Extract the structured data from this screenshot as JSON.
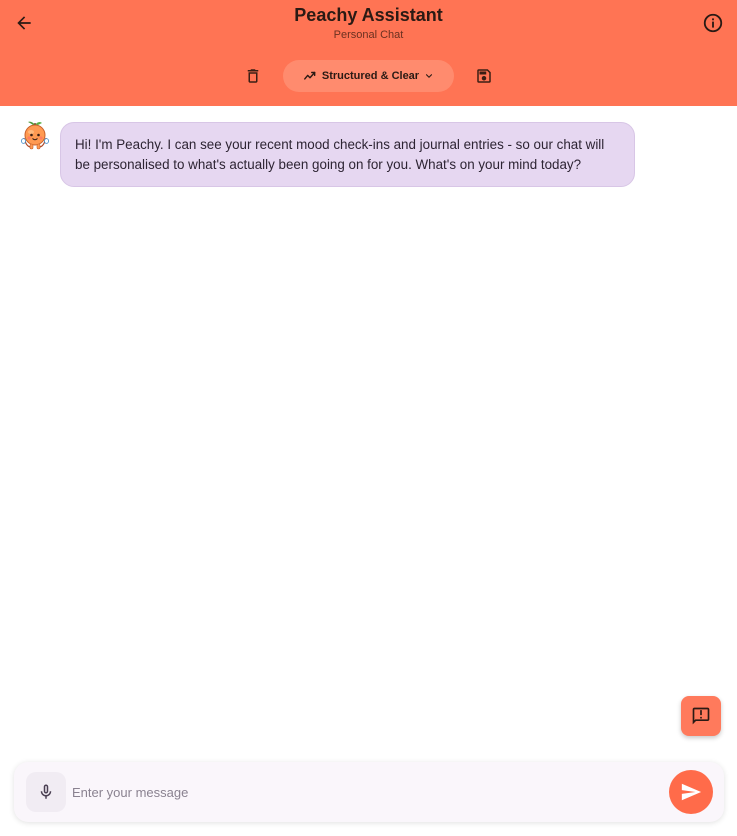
{
  "header": {
    "title": "Peachy Assistant",
    "subtitle": "Personal Chat",
    "style_label": "Structured & Clear",
    "icons": {
      "back": "arrow-left-icon",
      "info": "info-icon",
      "delete": "trash-icon",
      "save": "save-icon",
      "style": "trending-icon",
      "dropdown": "chevron-down-icon"
    }
  },
  "messages": [
    {
      "sender": "assistant",
      "avatar": "peach-mascot-icon",
      "text": "Hi! I'm Peachy. I can see your recent mood check-ins and journal entries - so our chat will be personalised to what's actually been going on for you. What's on your mind today?"
    }
  ],
  "composer": {
    "placeholder": "Enter your message",
    "value": "",
    "mic_icon": "microphone-icon",
    "send_icon": "send-icon"
  },
  "feedback": {
    "icon": "feedback-icon"
  },
  "colors": {
    "header_bg": "#ff7454",
    "pill_bg": "#ff8b6e",
    "bubble_bg": "#e6d7f1",
    "send_bg": "#ff6b4a"
  }
}
